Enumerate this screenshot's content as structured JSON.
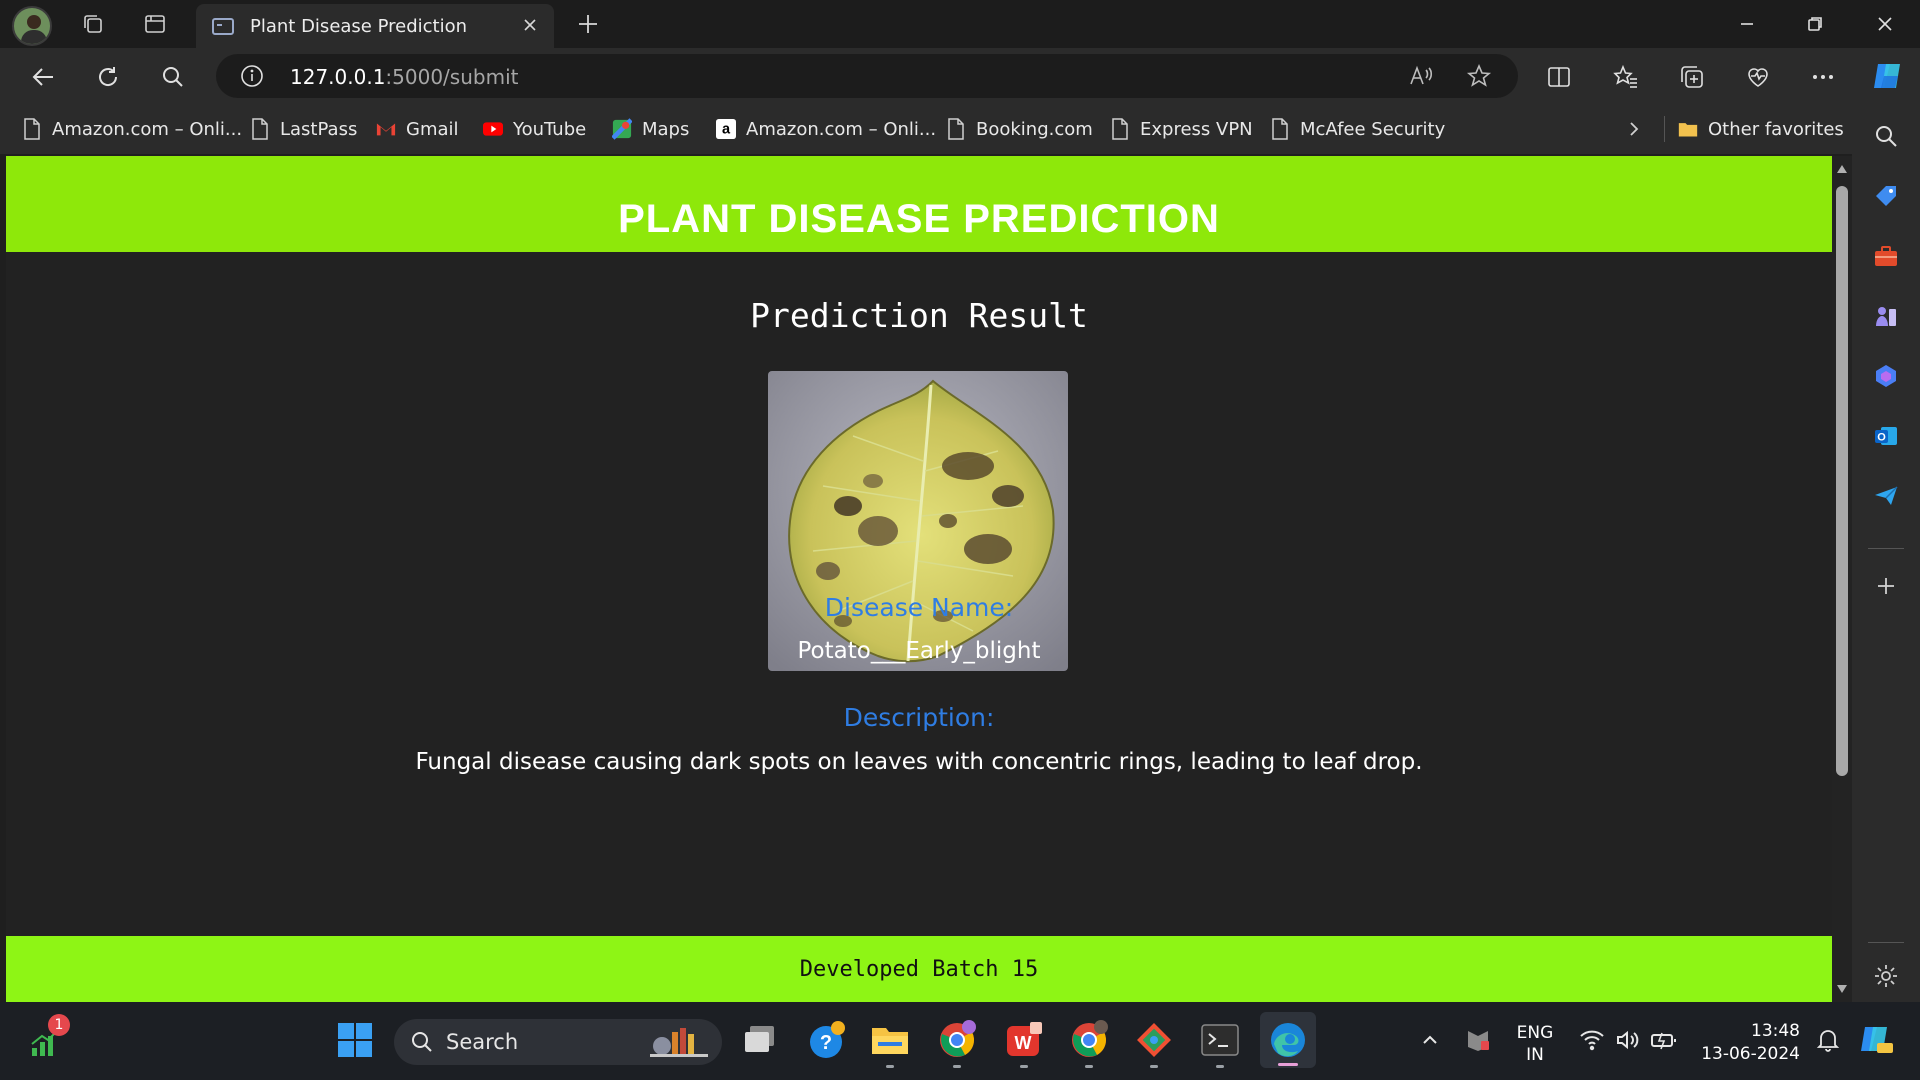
{
  "browser": {
    "tab_title": "Plant Disease Prediction",
    "url_host": "127.0.0.1",
    "url_path": ":5000/submit",
    "favorites": [
      {
        "label": "Amazon.com – Onli...",
        "icon": "page-icon"
      },
      {
        "label": "LastPass",
        "icon": "page-icon"
      },
      {
        "label": "Gmail",
        "icon": "gmail-icon"
      },
      {
        "label": "YouTube",
        "icon": "youtube-icon"
      },
      {
        "label": "Maps",
        "icon": "maps-icon"
      },
      {
        "label": "Amazon.com – Onli...",
        "icon": "amazon-icon"
      },
      {
        "label": "Booking.com",
        "icon": "page-icon"
      },
      {
        "label": "Express VPN",
        "icon": "page-icon"
      },
      {
        "label": "McAfee Security",
        "icon": "page-icon"
      }
    ],
    "other_favorites": "Other favorites"
  },
  "page": {
    "header_title": "PLANT DISEASE PREDICTION",
    "result_heading": "Prediction Result",
    "image_alt": "uploaded potato leaf image",
    "disease_label": "Disease Name:",
    "disease_value": "Potato___Early_blight",
    "description_label": "Description:",
    "description_value": "Fungal disease causing dark spots on leaves with concentric rings, leading to leaf drop.",
    "footer_text": "Developed Batch 15"
  },
  "colors": {
    "header_green": "#8ee80a",
    "footer_green": "#8ef515",
    "label_blue": "#2f7de3",
    "page_bg": "#222222"
  },
  "taskbar": {
    "search_label": "Search",
    "notification_count": "1",
    "language_line1": "ENG",
    "language_line2": "IN",
    "time": "13:48",
    "date": "13-06-2024"
  }
}
